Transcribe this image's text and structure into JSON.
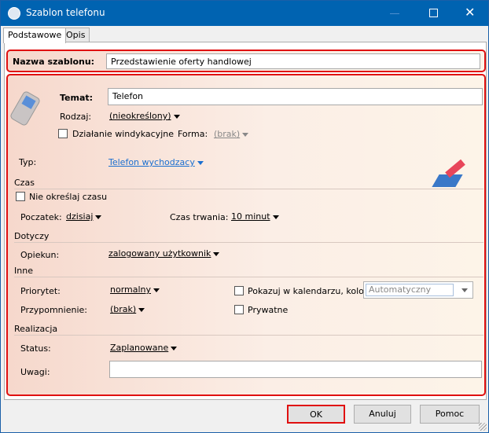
{
  "window": {
    "title": "Szablon telefonu"
  },
  "tabs": [
    {
      "label": "Podstawowe"
    },
    {
      "label": "Opis"
    }
  ],
  "name_field": {
    "label": "Nazwa szablonu:",
    "value": "Przedstawienie oferty handlowej"
  },
  "form": {
    "temat_label": "Temat:",
    "temat_value": "Telefon",
    "rodzaj_label": "Rodzaj:",
    "rodzaj_value": "(nieokreślony)",
    "windykacja_label": "Działanie windykacyjne",
    "forma_label": "Forma:",
    "forma_value": "(brak)",
    "typ_label": "Typ:",
    "typ_value": "Telefon wychodzacy",
    "czas_section": "Czas",
    "nie_okreslaj_label": "Nie określaj czasu",
    "poczatek_label": "Poczatek:",
    "poczatek_value": "dzisiaj",
    "czas_trwania_label": "Czas trwania:",
    "czas_trwania_value": "10 minut",
    "dotyczy_section": "Dotyczy",
    "opiekun_label": "Opiekun:",
    "opiekun_value": "zalogowany użytkownik",
    "inne_section": "Inne",
    "priorytet_label": "Priorytet:",
    "priorytet_value": "normalny",
    "kalendarz_label": "Pokazuj w kalendarzu, kolor:",
    "kolor_value": "Automatyczny",
    "przypomnienie_label": "Przypomnienie:",
    "przypomnienie_value": "(brak)",
    "prywatne_label": "Prywatne",
    "realizacja_section": "Realizacja",
    "status_label": "Status:",
    "status_value": "Zaplanowane",
    "uwagi_label": "Uwagi:",
    "uwagi_value": ""
  },
  "buttons": {
    "ok": "OK",
    "cancel": "Anuluj",
    "help": "Pomoc"
  }
}
